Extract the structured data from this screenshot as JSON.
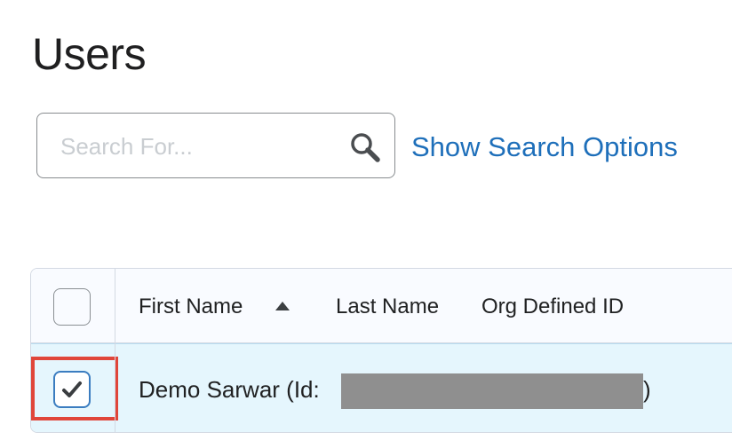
{
  "page": {
    "title": "Users"
  },
  "search": {
    "placeholder": "Search For...",
    "value": "",
    "icon": "search-icon",
    "show_options_label": "Show Search Options"
  },
  "table": {
    "columns": [
      {
        "label": "First Name",
        "sorted": "ascending"
      },
      {
        "label": "Last Name"
      },
      {
        "label": "Org Defined ID"
      }
    ],
    "rows": [
      {
        "selected": true,
        "name_prefix": "Demo Sarwar (Id:",
        "name_suffix": ")"
      }
    ]
  },
  "colors": {
    "link": "#1e6fba",
    "selected_row_bg": "#e5f6fd",
    "header_bg": "#f9fbff",
    "highlight_border": "#e0463a",
    "checkbox_border": "#3b7dc0",
    "redaction": "#8f8f8f"
  }
}
